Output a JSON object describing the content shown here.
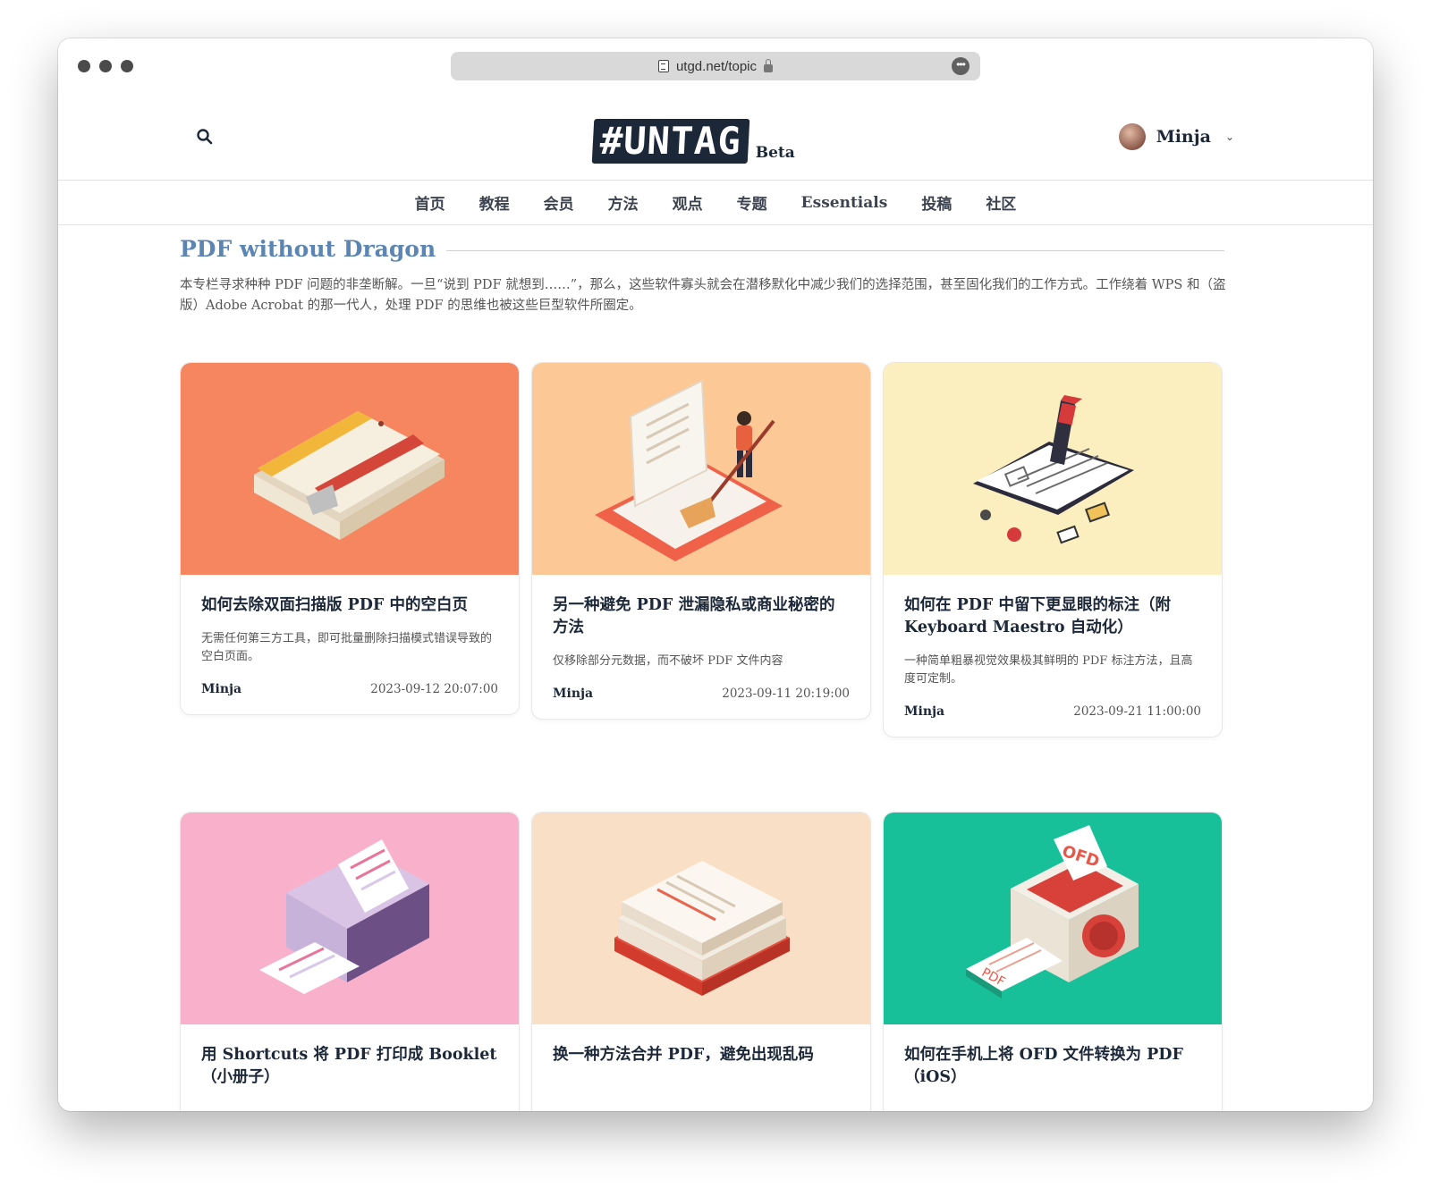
{
  "browser": {
    "url": "utgd.net/topic",
    "more_icon": "ellipsis-icon",
    "lock_icon": "lock-icon"
  },
  "header": {
    "search_icon": "search-icon",
    "logo_text": "#UNTAG",
    "logo_badge": "Beta",
    "user_name": "Minja",
    "user_menu_icon": "chevron-down-icon"
  },
  "nav": {
    "items": [
      "首页",
      "教程",
      "会员",
      "方法",
      "观点",
      "专题",
      "Essentials",
      "投稿",
      "社区"
    ]
  },
  "topic": {
    "title": "PDF without Dragon",
    "description": "本专栏寻求种种 PDF 问题的非垄断解。一旦“说到 PDF 就想到……”，那么，这些软件寡头就会在潜移默化中减少我们的选择范围，甚至固化我们的工作方式。工作绕着 WPS 和（盗版）Adobe Acrobat 的那一代人，处理 PDF 的思维也被这些巨型软件所圈定。"
  },
  "cards": [
    {
      "title": "如何去除双面扫描版 PDF 中的空白页",
      "excerpt": "无需任何第三方工具，即可批量删除扫描模式错误导致的空白页面。",
      "author": "Minja",
      "date": "2023-09-12 20:07:00",
      "image_bg": "#f68660",
      "image": "book-and-knife-illustration"
    },
    {
      "title": "另一种避免 PDF 泄漏隐私或商业秘密的方法",
      "excerpt": "仅移除部分元数据，而不破坏 PDF 文件内容",
      "author": "Minja",
      "date": "2023-09-11 20:19:00",
      "image_bg": "#fcc996",
      "image": "person-sweeping-document-illustration"
    },
    {
      "title": "如何在 PDF 中留下更显眼的标注（附 Keyboard Maestro 自动化）",
      "excerpt": "一种简单粗暴视觉效果极其鲜明的 PDF 标注方法，且高度可定制。",
      "author": "Minja",
      "date": "2023-09-21 11:00:00",
      "image_bg": "#fbefc0",
      "image": "marker-on-document-illustration"
    },
    {
      "title": "用 Shortcuts 将 PDF 打印成 Booklet（小册子）",
      "image_bg": "#f9b1cb",
      "image": "printer-illustration"
    },
    {
      "title": "换一种方法合并 PDF，避免出现乱码",
      "image_bg": "#f8dfc5",
      "image": "paper-stack-illustration"
    },
    {
      "title": "如何在手机上将 OFD 文件转换为 PDF（iOS）",
      "image_bg": "#18c09a",
      "image": "ofd-to-pdf-machine-illustration",
      "image_labels": [
        "OFD",
        "PDF"
      ]
    }
  ]
}
